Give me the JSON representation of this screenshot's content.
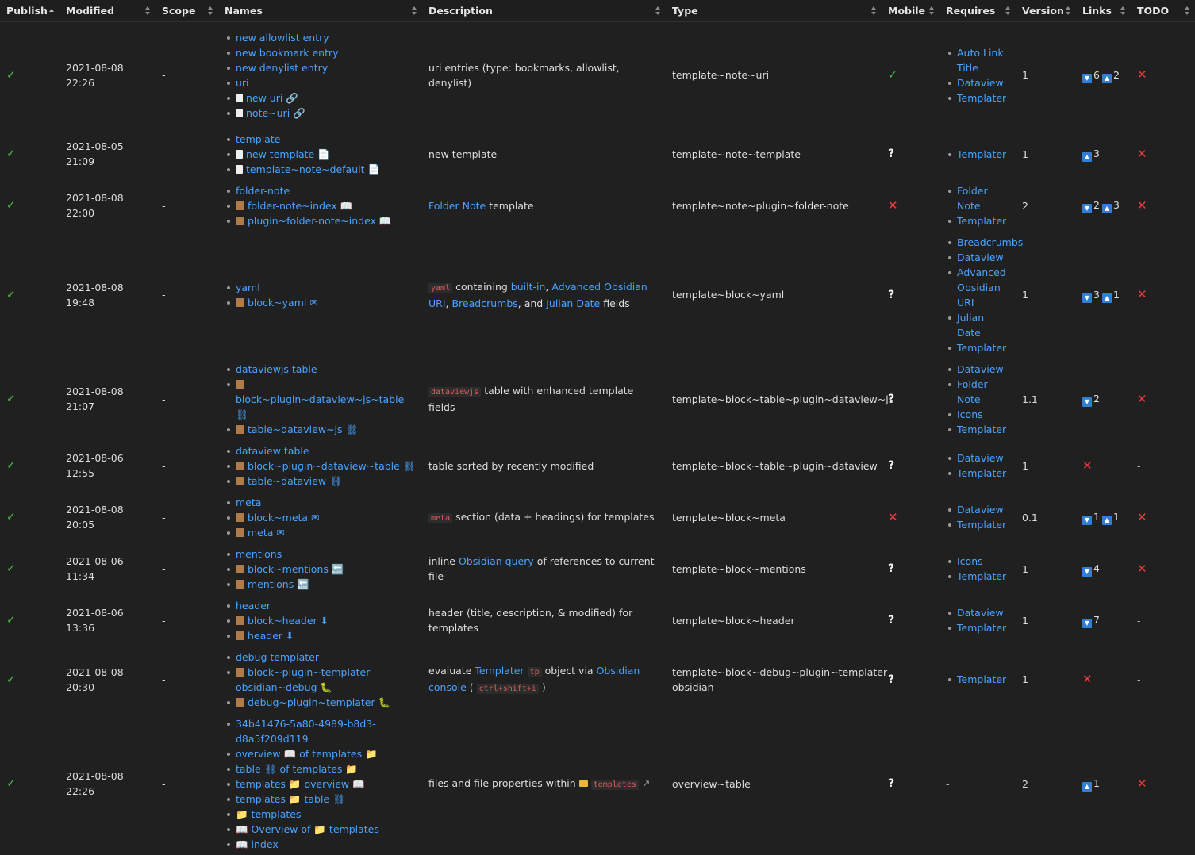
{
  "headers": {
    "publish": "Publish",
    "modified": "Modified",
    "scope": "Scope",
    "names": "Names",
    "description": "Description",
    "type": "Type",
    "mobile": "Mobile",
    "requires": "Requires",
    "version": "Version",
    "links": "Links",
    "todo": "TODO"
  },
  "symbols": {
    "check": "✓",
    "cross": "✕",
    "question": "?",
    "dash": "-",
    "down": "▼",
    "up": "▲"
  },
  "rows": [
    {
      "modified": "2021-08-08 22:26",
      "scope": "-",
      "names": [
        "new allowlist entry",
        "new bookmark entry",
        "new denylist entry",
        "uri",
        "new uri 🔗",
        "note~uri 🔗"
      ],
      "description": "uri entries (type: bookmarks, allowlist, denylist)",
      "type": "template~note~uri",
      "requires": [
        "Auto Link Title",
        "Dataview",
        "Templater"
      ],
      "version": "1",
      "links_down": "6",
      "links_up": "2"
    },
    {
      "modified": "2021-08-05 21:09",
      "scope": "-",
      "names": [
        "template",
        "new template 📄",
        "template~note~default 📄"
      ],
      "description": "new template",
      "type": "template~note~template",
      "requires": [
        "Templater"
      ],
      "version": "1",
      "links_up": "3"
    },
    {
      "modified": "2021-08-08 22:00",
      "scope": "-",
      "names": [
        "folder-note",
        "folder-note~index 📖",
        "plugin~folder-note~index 📖"
      ],
      "description_link": "Folder Note",
      "description_rest": " template",
      "type": "template~note~plugin~folder-note",
      "requires": [
        "Folder Note",
        "Templater"
      ],
      "version": "2",
      "links_down": "2",
      "links_up": "3"
    },
    {
      "modified": "2021-08-08 19:48",
      "scope": "-",
      "names": [
        "yaml",
        "block~yaml ✉"
      ],
      "desc_code": "yaml",
      "desc_text1": " containing ",
      "desc_link1": "built-in",
      "desc_text2": ", ",
      "desc_link2": "Advanced Obsidian URI",
      "desc_text3": ", ",
      "desc_link3": "Breadcrumbs",
      "desc_text4": ", and ",
      "desc_link4": "Julian Date",
      "desc_text5": " fields",
      "type": "template~block~yaml",
      "requires": [
        "Breadcrumbs",
        "Dataview",
        "Advanced Obsidian URI",
        "Julian Date",
        "Templater"
      ],
      "version": "1",
      "links_down": "3",
      "links_up": "1"
    },
    {
      "modified": "2021-08-08 21:07",
      "scope": "-",
      "names": [
        "dataviewjs table",
        "block~plugin~dataview~js~table ⛓",
        "table~dataview~js ⛓"
      ],
      "desc_code": "dataviewjs",
      "desc_text": " table with enhanced template fields",
      "type": "template~block~table~plugin~dataview~js",
      "requires": [
        "Dataview",
        "Folder Note",
        "Icons",
        "Templater"
      ],
      "version": "1.1",
      "links_down": "2"
    },
    {
      "modified": "2021-08-06 12:55",
      "scope": "-",
      "names": [
        "dataview table",
        "block~plugin~dataview~table ⛓",
        "table~dataview ⛓"
      ],
      "description": "table sorted by recently modified",
      "type": "template~block~table~plugin~dataview",
      "requires": [
        "Dataview",
        "Templater"
      ],
      "version": "1",
      "todo": "-"
    },
    {
      "modified": "2021-08-08 20:05",
      "scope": "-",
      "names": [
        "meta",
        "block~meta ✉",
        "meta ✉"
      ],
      "desc_code": "meta",
      "desc_text": " section (data + headings) for templates",
      "type": "template~block~meta",
      "requires": [
        "Dataview",
        "Templater"
      ],
      "version": "0.1",
      "links_down": "1",
      "links_up": "1"
    },
    {
      "modified": "2021-08-06 11:34",
      "scope": "-",
      "names": [
        "mentions",
        "block~mentions 🔙",
        "mentions 🔙"
      ],
      "desc_text1": "inline ",
      "desc_link1": "Obsidian query",
      "desc_text2": " of references to current file",
      "type": "template~block~mentions",
      "requires": [
        "Icons",
        "Templater"
      ],
      "version": "1",
      "links_down": "4"
    },
    {
      "modified": "2021-08-06 13:36",
      "scope": "-",
      "names": [
        "header",
        "block~header ⬇",
        "header ⬇"
      ],
      "description": "header (title, description, & modified) for templates",
      "type": "template~block~header",
      "requires": [
        "Dataview",
        "Templater"
      ],
      "version": "1",
      "links_down": "7",
      "todo": "-"
    },
    {
      "modified": "2021-08-08 20:30",
      "scope": "-",
      "names": [
        "debug templater",
        "block~plugin~templater-obsidian~debug 🐛",
        "debug~plugin~templater 🐛"
      ],
      "desc_text1": "evaluate ",
      "desc_link1": "Templater",
      "desc_code1": "tp",
      "desc_text2": " object via ",
      "desc_link2": "Obsidian console",
      "desc_text3": " ( ",
      "desc_code2": "ctrl+shift+i",
      "desc_text4": " )",
      "type": "template~block~debug~plugin~templater-obsidian",
      "requires": [
        "Templater"
      ],
      "version": "1",
      "todo": "-"
    },
    {
      "modified": "2021-08-08 22:26",
      "scope": "-",
      "names": [
        "34b41476-5a80-4989-b8d3-d8a5f209d119",
        "overview 📖 of templates 📁",
        "table ⛓ of templates 📁",
        "templates 📁 overview 📖",
        "templates 📁 table ⛓",
        "📁 templates",
        "📖 Overview of 📁 templates",
        "📖 index"
      ],
      "desc_text": "files and file properties within ",
      "desc_link": "templates",
      "type": "overview~table",
      "requires_dash": "-",
      "version": "2",
      "links_up": "1"
    }
  ]
}
